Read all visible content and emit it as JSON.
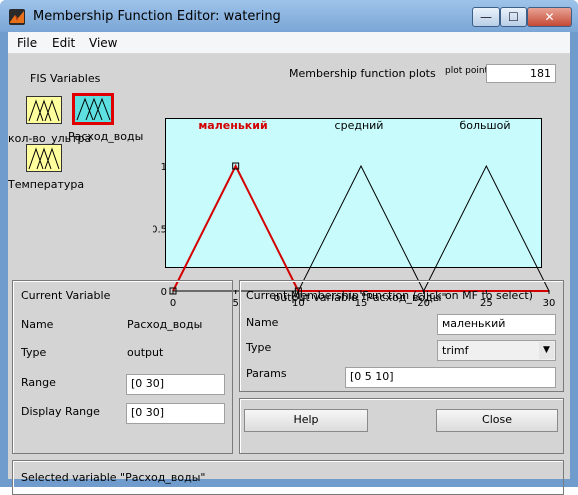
{
  "window": {
    "title": "Membership Function Editor: watering",
    "controls": {
      "minimize": "—",
      "maximize": "☐",
      "close": "✕"
    }
  },
  "menu": [
    "File",
    "Edit",
    "View"
  ],
  "fis": {
    "heading": "FIS Variables",
    "variables": [
      {
        "label": "кол-во_ультра",
        "selected": false
      },
      {
        "label": "Расход_воды",
        "selected": true
      },
      {
        "label": "Температура",
        "selected": false
      }
    ]
  },
  "plot": {
    "title": "Membership function plots",
    "plot_points_label": "plot points",
    "plot_points_value": "181",
    "xlabel": "output variable \"Расход_воды\"",
    "xticks": [
      "0",
      "5",
      "10",
      "15",
      "20",
      "25",
      "30"
    ],
    "yticks": [
      "0",
      "0.5",
      "1"
    ],
    "mf_labels": [
      "маленький",
      "средний",
      "большой"
    ]
  },
  "chart_data": {
    "type": "line",
    "xlabel": "output variable \"Расход_воды\"",
    "xlim": [
      0,
      30
    ],
    "ylim": [
      0,
      1
    ],
    "series": [
      {
        "name": "маленький",
        "x": [
          0,
          5,
          10
        ],
        "y": [
          0,
          1,
          0
        ],
        "color": "#d40000",
        "selected": true
      },
      {
        "name": "средний",
        "x": [
          10,
          15,
          20
        ],
        "y": [
          0,
          1,
          0
        ],
        "color": "#000000",
        "selected": false
      },
      {
        "name": "большой",
        "x": [
          20,
          25,
          30
        ],
        "y": [
          0,
          1,
          0
        ],
        "color": "#000000",
        "selected": false
      }
    ]
  },
  "current_variable": {
    "title": "Current Variable",
    "name_label": "Name",
    "name_value": "Расход_воды",
    "type_label": "Type",
    "type_value": "output",
    "range_label": "Range",
    "range_value": "[0 30]",
    "display_range_label": "Display Range",
    "display_range_value": "[0 30]"
  },
  "current_mf": {
    "title": "Current Membership Function (click on MF to select)",
    "name_label": "Name",
    "name_value": "маленький",
    "type_label": "Type",
    "type_value": "trimf",
    "params_label": "Params",
    "params_value": "[0 5 10]"
  },
  "buttons": {
    "help": "Help",
    "close": "Close"
  },
  "status": "Selected variable \"Расход_воды\"",
  "colors": {
    "plot_bg": "#c8fcfc",
    "fis_box": "#ffff9e",
    "selected_mf": "#d40000"
  }
}
